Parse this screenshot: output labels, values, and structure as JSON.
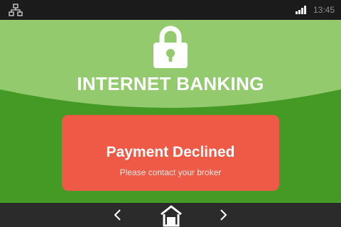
{
  "status_bar": {
    "network_icon": "network-icon",
    "signal_icon": "signal-bars-icon",
    "time": "13:45"
  },
  "header": {
    "icon": "padlock-icon",
    "title": "INTERNET BANKING"
  },
  "alert": {
    "title": "Payment Declined",
    "message": "Please contact your broker"
  },
  "nav": {
    "back_icon": "chevron-left-icon",
    "home_icon": "home-icon",
    "forward_icon": "chevron-right-icon"
  },
  "colors": {
    "status_bar": "#1b1b1b",
    "header_light_green": "#93ca6e",
    "body_green": "#449a24",
    "alert_red": "#ef5a47",
    "nav_bar": "#2b2b2b",
    "white": "#ffffff"
  }
}
